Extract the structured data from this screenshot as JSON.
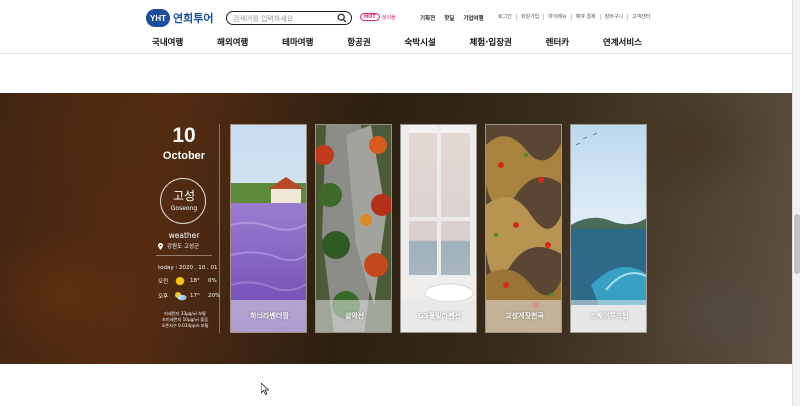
{
  "header": {
    "logo_badge": "YHT",
    "logo_text": "연희투어",
    "search_placeholder": "검색어를 입력하세요",
    "hot_badge": "HOT",
    "hot_text": "레이블",
    "quick_links": [
      "기획전",
      "핫딜",
      "기업여행"
    ],
    "util_links": [
      "로그인",
      "회원가입",
      "마이메뉴",
      "예약·결제",
      "장바구니",
      "고객센터"
    ]
  },
  "gnb": [
    "국내여행",
    "해외여행",
    "테마여행",
    "항공권",
    "숙박시설",
    "체험·입장권",
    "렌터카",
    "연계서비스"
  ],
  "feature": {
    "day": "10",
    "month": "October",
    "place_ko": "고성",
    "place_en": "Goseong",
    "weather_label": "weather",
    "location": "강원도 고성군",
    "today": "today : 2020 . 10 . 01",
    "am": {
      "label": "오전",
      "temp": "18°",
      "rain": "0%"
    },
    "pm": {
      "label": "오후",
      "temp": "17°",
      "rain": "20%"
    },
    "air": [
      "미세먼지 33μg/㎥ 보통",
      "초미세먼지 10μg/㎥ 좋음",
      "오존지수 0.034ppm 보통"
    ],
    "cards": [
      "하늬라벤더팜",
      "설악산",
      "GS풀빌라펜션",
      "고성게장천국",
      "스퀘어루프탑"
    ]
  },
  "colors": {
    "brand": "#1d4e9c",
    "hot": "#d72d7c",
    "sun": "#f5c518"
  }
}
